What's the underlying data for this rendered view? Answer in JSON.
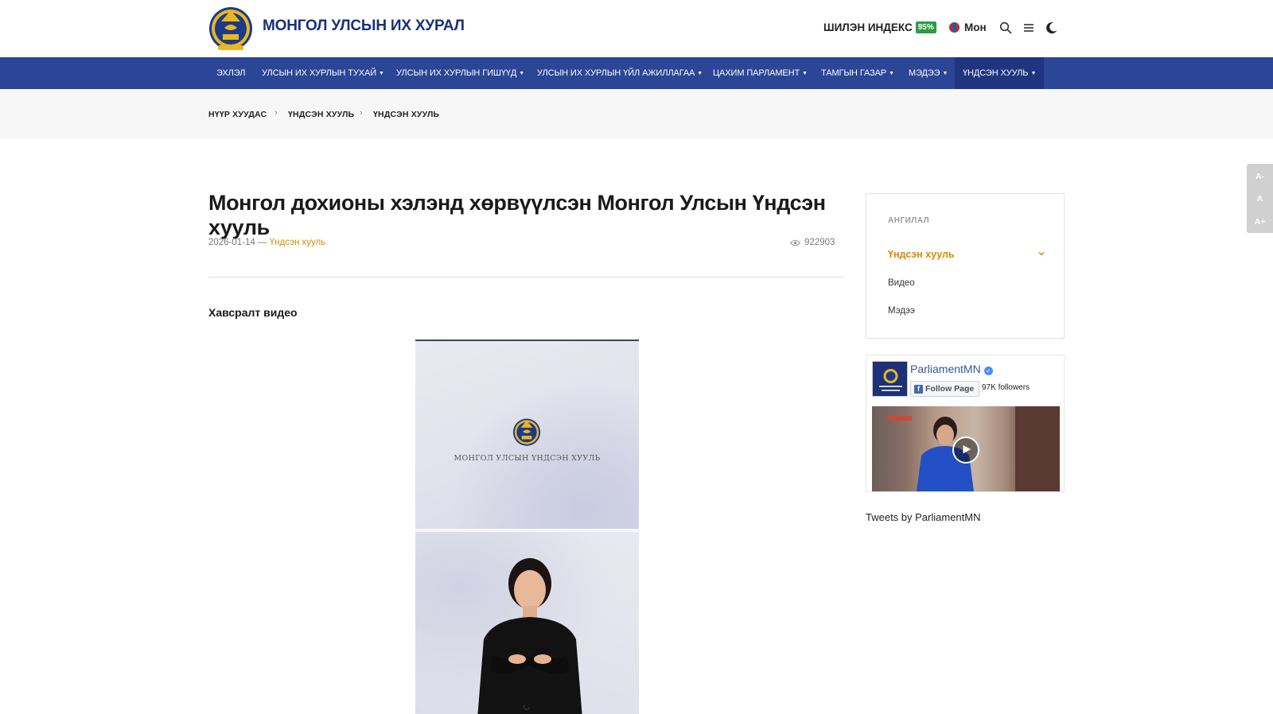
{
  "header": {
    "site_title": "МОНГОЛ УЛСЫН ИХ ХУРАЛ",
    "index_label": "ШИЛЭН ИНДЕКС",
    "index_value": "95%",
    "language": "Мон",
    "icons": [
      "state-emblem-logo",
      "search-icon",
      "menu-icon",
      "dark-mode-moon-icon"
    ]
  },
  "nav": {
    "items": [
      "ЭХЛЭЛ",
      "УЛСЫН ИХ ХУРЛЫН ТУХАЙ",
      "УЛСЫН ИХ ХУРЛЫН ГИШҮҮД",
      "УЛСЫН ИХ ХУРЛЫН ҮЙЛ АЖИЛЛАГАА",
      "ЦАХИМ ПАРЛАМЕНТ",
      "ТАМГЫН ГАЗАР",
      "МЭДЭЭ",
      "ҮНДСЭН ХУУЛЬ"
    ],
    "active": "ҮНДСЭН ХУУЛЬ"
  },
  "breadcrumb": [
    "НҮҮР ХУУДАС",
    "ҮНДСЭН ХУУЛЬ",
    "ҮНДСЭН ХУУЛЬ"
  ],
  "article": {
    "title": "Монгол дохионы хэлэнд хөрвүүлсэн Монгол Улсын Үндсэн хууль",
    "date": "2026-01-14",
    "date_sep": "—",
    "category": "Үндсэн хууль",
    "views": "922903",
    "attachment_heading": "Хавсралт видео",
    "video_caption": "МОНГОЛ УЛСЫН ҮНДСЭН ХУУЛЬ"
  },
  "sidebar": {
    "heading": "АНГИЛАЛ",
    "items": [
      "Үндсэн хууль",
      "Видео",
      "Мэдээ"
    ]
  },
  "facebook": {
    "page_name": "ParliamentMN",
    "follow_label": "Follow Page",
    "followers": "97K followers"
  },
  "tweets_label": "Tweets by ParliamentMN",
  "font_tool": [
    "A-",
    "A",
    "A+"
  ],
  "colors": {
    "nav_bg": "#2b4597",
    "title_blue": "#1a2f7a",
    "accent_orange": "#d98a00",
    "index_green": "#2e9b47"
  }
}
